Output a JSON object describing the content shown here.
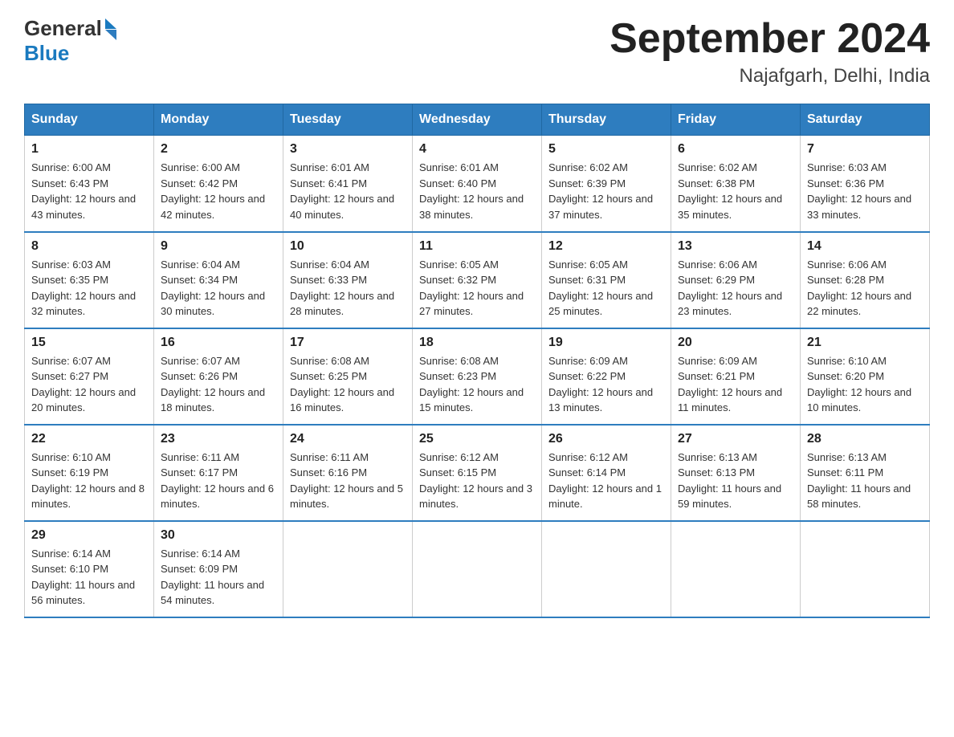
{
  "header": {
    "logo_general": "General",
    "logo_blue": "Blue",
    "month_year": "September 2024",
    "location": "Najafgarh, Delhi, India"
  },
  "weekdays": [
    "Sunday",
    "Monday",
    "Tuesday",
    "Wednesday",
    "Thursday",
    "Friday",
    "Saturday"
  ],
  "weeks": [
    [
      {
        "day": "1",
        "sunrise": "Sunrise: 6:00 AM",
        "sunset": "Sunset: 6:43 PM",
        "daylight": "Daylight: 12 hours and 43 minutes."
      },
      {
        "day": "2",
        "sunrise": "Sunrise: 6:00 AM",
        "sunset": "Sunset: 6:42 PM",
        "daylight": "Daylight: 12 hours and 42 minutes."
      },
      {
        "day": "3",
        "sunrise": "Sunrise: 6:01 AM",
        "sunset": "Sunset: 6:41 PM",
        "daylight": "Daylight: 12 hours and 40 minutes."
      },
      {
        "day": "4",
        "sunrise": "Sunrise: 6:01 AM",
        "sunset": "Sunset: 6:40 PM",
        "daylight": "Daylight: 12 hours and 38 minutes."
      },
      {
        "day": "5",
        "sunrise": "Sunrise: 6:02 AM",
        "sunset": "Sunset: 6:39 PM",
        "daylight": "Daylight: 12 hours and 37 minutes."
      },
      {
        "day": "6",
        "sunrise": "Sunrise: 6:02 AM",
        "sunset": "Sunset: 6:38 PM",
        "daylight": "Daylight: 12 hours and 35 minutes."
      },
      {
        "day": "7",
        "sunrise": "Sunrise: 6:03 AM",
        "sunset": "Sunset: 6:36 PM",
        "daylight": "Daylight: 12 hours and 33 minutes."
      }
    ],
    [
      {
        "day": "8",
        "sunrise": "Sunrise: 6:03 AM",
        "sunset": "Sunset: 6:35 PM",
        "daylight": "Daylight: 12 hours and 32 minutes."
      },
      {
        "day": "9",
        "sunrise": "Sunrise: 6:04 AM",
        "sunset": "Sunset: 6:34 PM",
        "daylight": "Daylight: 12 hours and 30 minutes."
      },
      {
        "day": "10",
        "sunrise": "Sunrise: 6:04 AM",
        "sunset": "Sunset: 6:33 PM",
        "daylight": "Daylight: 12 hours and 28 minutes."
      },
      {
        "day": "11",
        "sunrise": "Sunrise: 6:05 AM",
        "sunset": "Sunset: 6:32 PM",
        "daylight": "Daylight: 12 hours and 27 minutes."
      },
      {
        "day": "12",
        "sunrise": "Sunrise: 6:05 AM",
        "sunset": "Sunset: 6:31 PM",
        "daylight": "Daylight: 12 hours and 25 minutes."
      },
      {
        "day": "13",
        "sunrise": "Sunrise: 6:06 AM",
        "sunset": "Sunset: 6:29 PM",
        "daylight": "Daylight: 12 hours and 23 minutes."
      },
      {
        "day": "14",
        "sunrise": "Sunrise: 6:06 AM",
        "sunset": "Sunset: 6:28 PM",
        "daylight": "Daylight: 12 hours and 22 minutes."
      }
    ],
    [
      {
        "day": "15",
        "sunrise": "Sunrise: 6:07 AM",
        "sunset": "Sunset: 6:27 PM",
        "daylight": "Daylight: 12 hours and 20 minutes."
      },
      {
        "day": "16",
        "sunrise": "Sunrise: 6:07 AM",
        "sunset": "Sunset: 6:26 PM",
        "daylight": "Daylight: 12 hours and 18 minutes."
      },
      {
        "day": "17",
        "sunrise": "Sunrise: 6:08 AM",
        "sunset": "Sunset: 6:25 PM",
        "daylight": "Daylight: 12 hours and 16 minutes."
      },
      {
        "day": "18",
        "sunrise": "Sunrise: 6:08 AM",
        "sunset": "Sunset: 6:23 PM",
        "daylight": "Daylight: 12 hours and 15 minutes."
      },
      {
        "day": "19",
        "sunrise": "Sunrise: 6:09 AM",
        "sunset": "Sunset: 6:22 PM",
        "daylight": "Daylight: 12 hours and 13 minutes."
      },
      {
        "day": "20",
        "sunrise": "Sunrise: 6:09 AM",
        "sunset": "Sunset: 6:21 PM",
        "daylight": "Daylight: 12 hours and 11 minutes."
      },
      {
        "day": "21",
        "sunrise": "Sunrise: 6:10 AM",
        "sunset": "Sunset: 6:20 PM",
        "daylight": "Daylight: 12 hours and 10 minutes."
      }
    ],
    [
      {
        "day": "22",
        "sunrise": "Sunrise: 6:10 AM",
        "sunset": "Sunset: 6:19 PM",
        "daylight": "Daylight: 12 hours and 8 minutes."
      },
      {
        "day": "23",
        "sunrise": "Sunrise: 6:11 AM",
        "sunset": "Sunset: 6:17 PM",
        "daylight": "Daylight: 12 hours and 6 minutes."
      },
      {
        "day": "24",
        "sunrise": "Sunrise: 6:11 AM",
        "sunset": "Sunset: 6:16 PM",
        "daylight": "Daylight: 12 hours and 5 minutes."
      },
      {
        "day": "25",
        "sunrise": "Sunrise: 6:12 AM",
        "sunset": "Sunset: 6:15 PM",
        "daylight": "Daylight: 12 hours and 3 minutes."
      },
      {
        "day": "26",
        "sunrise": "Sunrise: 6:12 AM",
        "sunset": "Sunset: 6:14 PM",
        "daylight": "Daylight: 12 hours and 1 minute."
      },
      {
        "day": "27",
        "sunrise": "Sunrise: 6:13 AM",
        "sunset": "Sunset: 6:13 PM",
        "daylight": "Daylight: 11 hours and 59 minutes."
      },
      {
        "day": "28",
        "sunrise": "Sunrise: 6:13 AM",
        "sunset": "Sunset: 6:11 PM",
        "daylight": "Daylight: 11 hours and 58 minutes."
      }
    ],
    [
      {
        "day": "29",
        "sunrise": "Sunrise: 6:14 AM",
        "sunset": "Sunset: 6:10 PM",
        "daylight": "Daylight: 11 hours and 56 minutes."
      },
      {
        "day": "30",
        "sunrise": "Sunrise: 6:14 AM",
        "sunset": "Sunset: 6:09 PM",
        "daylight": "Daylight: 11 hours and 54 minutes."
      },
      null,
      null,
      null,
      null,
      null
    ]
  ]
}
